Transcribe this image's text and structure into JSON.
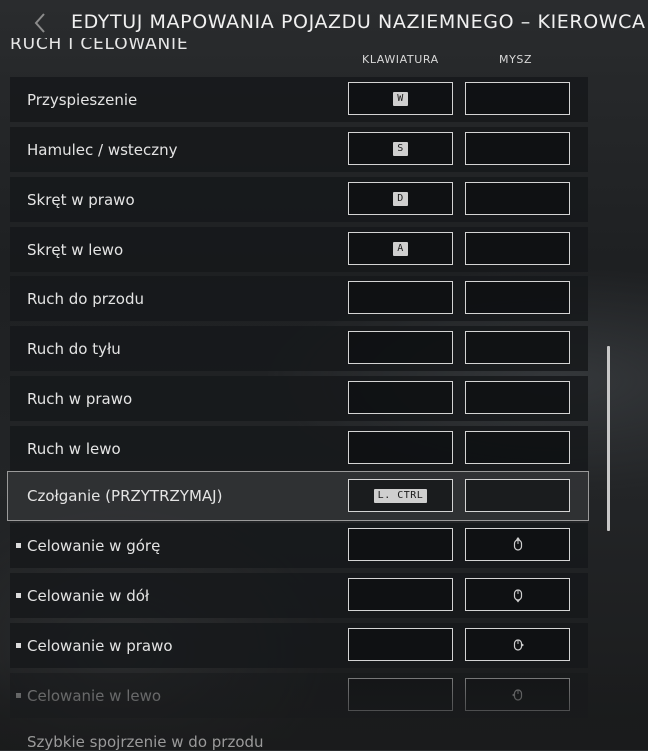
{
  "header": {
    "title": "EDYTUJ MAPOWANIA POJAZDU NAZIEMNEGO – KIEROWCA",
    "section": "RUCH I CELOWANIE",
    "col_keyboard": "KLAWIATURA",
    "col_mouse": "MYSZ"
  },
  "rows": [
    {
      "label": "Przyspieszenie",
      "key": "W",
      "mouse_icon": "",
      "bullet": false
    },
    {
      "label": "Hamulec / wsteczny",
      "key": "S",
      "mouse_icon": "",
      "bullet": false
    },
    {
      "label": "Skręt w prawo",
      "key": "D",
      "mouse_icon": "",
      "bullet": false
    },
    {
      "label": "Skręt w lewo",
      "key": "A",
      "mouse_icon": "",
      "bullet": false
    },
    {
      "label": "Ruch do przodu",
      "key": "",
      "mouse_icon": "",
      "bullet": false
    },
    {
      "label": "Ruch do tyłu",
      "key": "",
      "mouse_icon": "",
      "bullet": false
    },
    {
      "label": "Ruch w prawo",
      "key": "",
      "mouse_icon": "",
      "bullet": false
    },
    {
      "label": "Ruch w lewo",
      "key": "",
      "mouse_icon": "",
      "bullet": false
    },
    {
      "label": "Czołganie (PRZYTRZYMAJ)",
      "key": "L. CTRL",
      "mouse_icon": "",
      "bullet": false,
      "selected": true
    },
    {
      "label": "Celowanie w górę",
      "key": "",
      "mouse_icon": "mouse-up-icon",
      "bullet": true
    },
    {
      "label": "Celowanie w dół",
      "key": "",
      "mouse_icon": "mouse-down-icon",
      "bullet": true
    },
    {
      "label": "Celowanie w prawo",
      "key": "",
      "mouse_icon": "mouse-right-icon",
      "bullet": true
    },
    {
      "label": "Celowanie w lewo",
      "key": "",
      "mouse_icon": "mouse-left-icon",
      "bullet": true
    }
  ],
  "partial_row_label": "Szybkie spojrzenie w do przodu",
  "colors": {
    "slot_border": "#d4d4d4",
    "key_bg": "#cfcfcf",
    "row_bg": "#16181b"
  },
  "icons": {
    "back": "back-chevron-icon"
  }
}
